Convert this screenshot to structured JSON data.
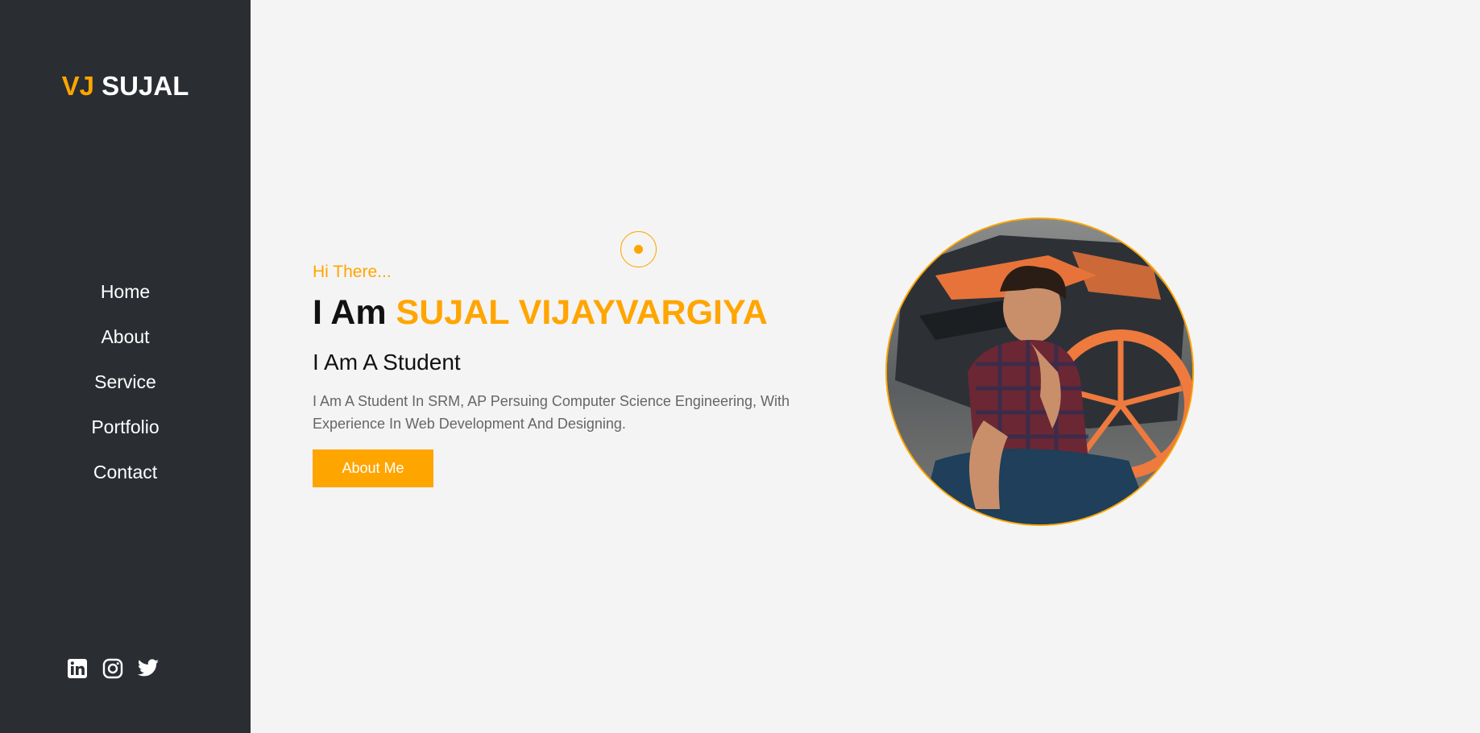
{
  "logo": {
    "accent": "VJ",
    "name": "SUJAL"
  },
  "nav": {
    "items": [
      {
        "label": "Home"
      },
      {
        "label": "About"
      },
      {
        "label": "Service"
      },
      {
        "label": "Portfolio"
      },
      {
        "label": "Contact"
      }
    ]
  },
  "socials": [
    "linkedin-icon",
    "instagram-icon",
    "twitter-icon"
  ],
  "hero": {
    "greeting": "Hi There...",
    "headline_prefix": "I Am",
    "headline_name": "SUJAL VIJAYVARGIYA",
    "role": "I Am A Student",
    "description": "I Am A Student In SRM, AP Persuing Computer Science Engineering, With Experience In Web Development And Designing.",
    "button_label": "About Me"
  },
  "colors": {
    "accent": "#ffa500",
    "sidebar": "#2a2e33",
    "background": "#f4f4f4"
  }
}
